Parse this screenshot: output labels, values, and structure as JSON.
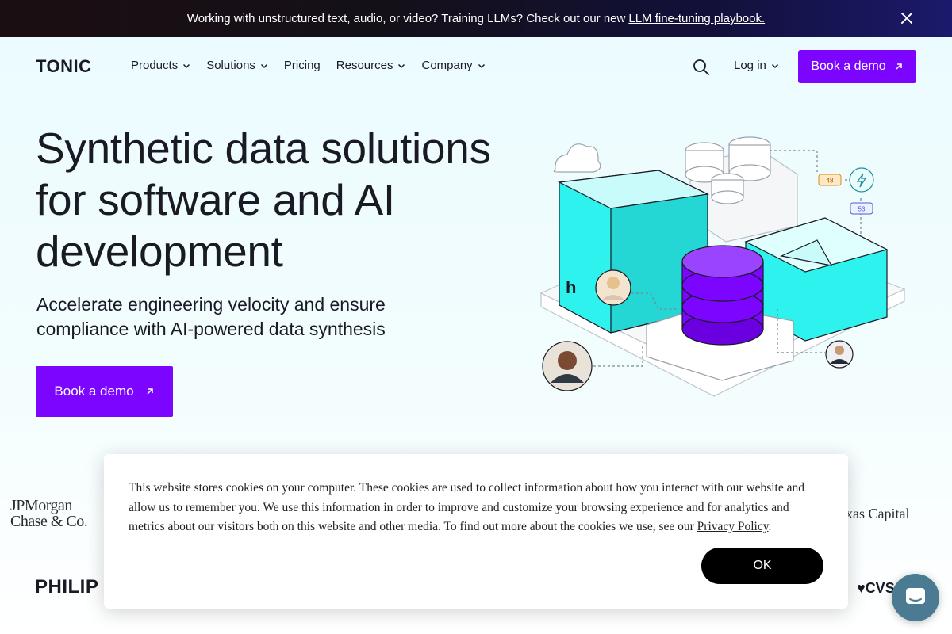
{
  "announcement": {
    "text": "Working with unstructured text, audio, or video? Training LLMs? Check out our new",
    "link_text": "LLM fine-tuning playbook."
  },
  "nav": {
    "logo_text": "TONIC",
    "items": [
      {
        "label": "Products",
        "has_dropdown": true
      },
      {
        "label": "Solutions",
        "has_dropdown": true
      },
      {
        "label": "Pricing",
        "has_dropdown": false
      },
      {
        "label": "Resources",
        "has_dropdown": true
      },
      {
        "label": "Company",
        "has_dropdown": true
      }
    ],
    "login_label": "Log in",
    "demo_label": "Book a demo"
  },
  "hero": {
    "title": "Synthetic data solutions for software and AI development",
    "subtitle": "Accelerate engineering velocity and ensure compliance with AI-powered data synthesis",
    "cta_label": "Book a demo",
    "badges": [
      "48",
      "53"
    ]
  },
  "customer_logos": {
    "jpmorgan_line1": "JPMorgan",
    "jpmorgan_line2": "Chase & Co.",
    "texas_capital": "exas Capital",
    "philips": "PHILIP",
    "cvs": "♥CVS"
  },
  "cookie_banner": {
    "text": "This website stores cookies on your computer. These cookies are used to collect information about how you interact with our website and allow us to remember you. We use this information in order to improve and customize your browsing experience and for analytics and metrics about our visitors both on this website and other media. To find out more about the cookies we use, see our",
    "link_text": "Privacy Policy",
    "ok_label": "OK"
  },
  "colors": {
    "brand_purple": "#7b05ff",
    "cyan": "#2ef2ee",
    "dark": "#1a1a24",
    "chat_bubble": "#4b7b92"
  },
  "icons": {
    "close": "close-icon",
    "search": "search-icon",
    "chevron": "chevron-down-icon",
    "arrow": "arrow-up-right-icon",
    "chat": "chat-icon"
  }
}
